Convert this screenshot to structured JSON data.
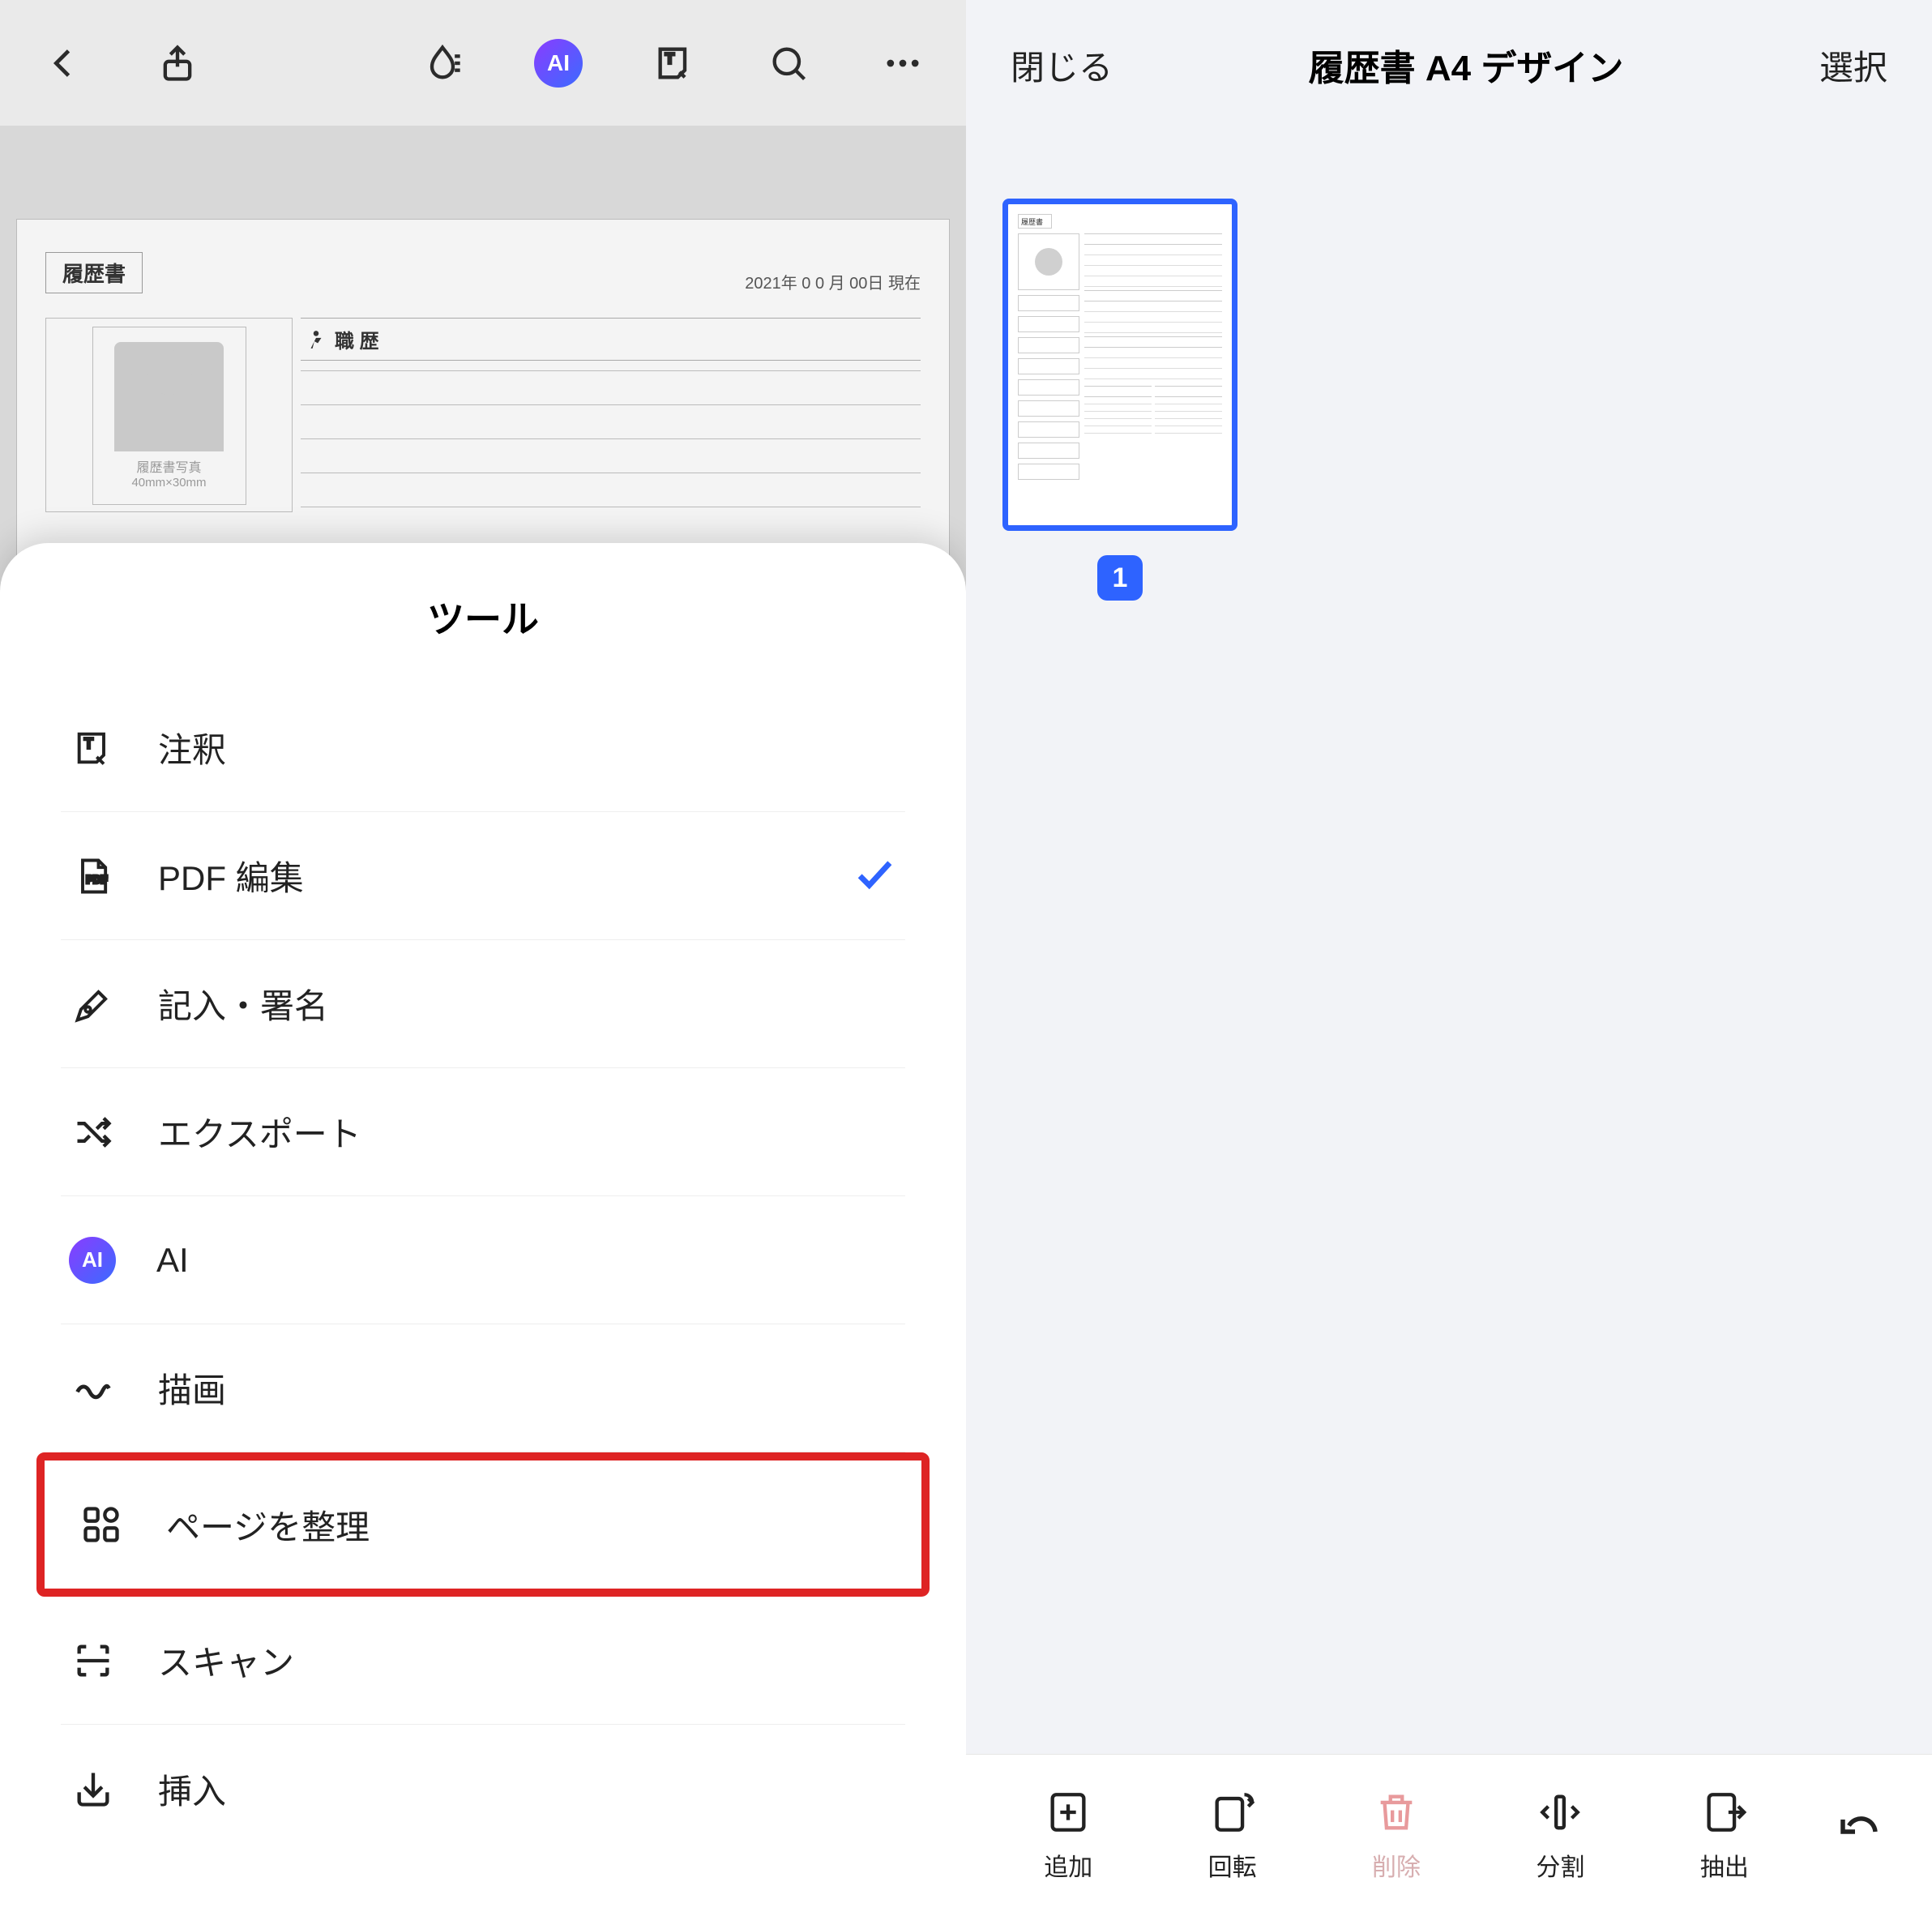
{
  "left": {
    "doc": {
      "title": "履歴書",
      "date": "2021年 0 0 月 00日 現在",
      "section": "職 歴",
      "photo_label1": "履歴書写真",
      "photo_label2": "40mm×30mm"
    },
    "sheet": {
      "title": "ツール",
      "items": [
        {
          "label": "注釈",
          "icon": "annotate",
          "checked": false
        },
        {
          "label": "PDF 編集",
          "icon": "pdf",
          "checked": true
        },
        {
          "label": "記入・署名",
          "icon": "sign",
          "checked": false
        },
        {
          "label": "エクスポート",
          "icon": "export",
          "checked": false
        },
        {
          "label": "AI",
          "icon": "ai",
          "checked": false
        },
        {
          "label": "描画",
          "icon": "draw",
          "checked": false
        },
        {
          "label": "ページを整理",
          "icon": "organize",
          "checked": false,
          "highlight": true
        },
        {
          "label": "スキャン",
          "icon": "scan",
          "checked": false
        },
        {
          "label": "挿入",
          "icon": "insert",
          "checked": false
        }
      ]
    },
    "toolbar_ai": "AI"
  },
  "right": {
    "close": "閉じる",
    "title": "履歴書 A4 デザイン",
    "select": "選択",
    "page_number": "1",
    "bottom": {
      "add": "追加",
      "rotate": "回転",
      "delete": "削除",
      "split": "分割",
      "extract": "抽出"
    }
  }
}
